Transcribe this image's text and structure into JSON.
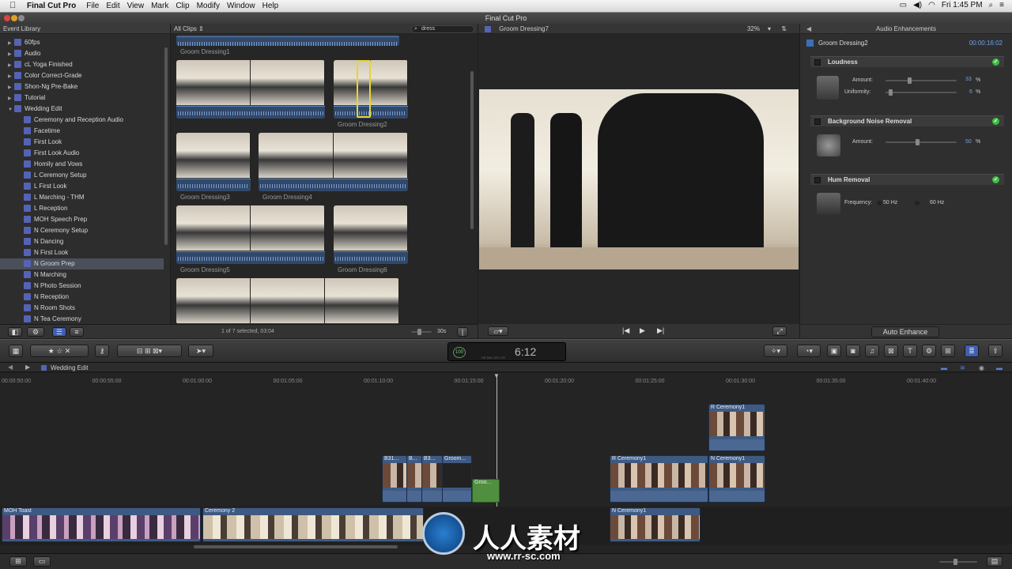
{
  "menubar": {
    "app": "Final Cut Pro",
    "items": [
      "File",
      "Edit",
      "View",
      "Mark",
      "Clip",
      "Modify",
      "Window",
      "Help"
    ],
    "clock": "Fri 1:45 PM"
  },
  "window": {
    "title": "Final Cut Pro"
  },
  "library": {
    "header": "Event Library",
    "items": [
      {
        "label": "60fps",
        "level": 0
      },
      {
        "label": "Audio",
        "level": 0
      },
      {
        "label": "cL Yoga Finished",
        "level": 0
      },
      {
        "label": "Color Correct-Grade",
        "level": 0
      },
      {
        "label": "Shon-Ng Pre-Bake",
        "level": 0
      },
      {
        "label": "Tutorial",
        "level": 0
      },
      {
        "label": "Wedding Edit",
        "level": 0,
        "open": true
      },
      {
        "label": "Ceremony and Reception Audio",
        "level": 1
      },
      {
        "label": "Facetime",
        "level": 1
      },
      {
        "label": "First Look",
        "level": 1
      },
      {
        "label": "First Look Audio",
        "level": 1
      },
      {
        "label": "Homily and Vows",
        "level": 1
      },
      {
        "label": "L Ceremony Setup",
        "level": 1
      },
      {
        "label": "L First Look",
        "level": 1
      },
      {
        "label": "L Marching - THM",
        "level": 1
      },
      {
        "label": "L Reception",
        "level": 1
      },
      {
        "label": "MOH Speech Prep",
        "level": 1
      },
      {
        "label": "N Ceremony Setup",
        "level": 1
      },
      {
        "label": "N Dancing",
        "level": 1
      },
      {
        "label": "N First Look",
        "level": 1
      },
      {
        "label": "N Groom Prep",
        "level": 1,
        "selected": true
      },
      {
        "label": "N Marching",
        "level": 1
      },
      {
        "label": "N Photo Session",
        "level": 1
      },
      {
        "label": "N Reception",
        "level": 1
      },
      {
        "label": "N Room Shots",
        "level": 1
      },
      {
        "label": "N Tea Ceremony",
        "level": 1
      }
    ]
  },
  "browser": {
    "filter": "All Clips",
    "search": "dress",
    "status": "1 of 7 selected, 03:04",
    "duration": "30s",
    "clips": [
      "Groom Dressing1",
      "Groom Dressing2",
      "Groom Dressing3",
      "Groom Dressing4",
      "Groom Dressing5",
      "Groom Dressing6"
    ]
  },
  "viewer": {
    "title": "Groom Dressing7",
    "zoom": "32%"
  },
  "inspector": {
    "header": "Audio Enhancements",
    "clip": "Groom Dressing2",
    "timecode": "00:00:16:02",
    "loudness": {
      "title": "Loudness",
      "amount_label": "Amount:",
      "amount": "33",
      "uniformity_label": "Uniformity:",
      "uniformity": "6",
      "unit": "%"
    },
    "noise": {
      "title": "Background Noise Removal",
      "amount_label": "Amount:",
      "amount": "50",
      "unit": "%"
    },
    "hum": {
      "title": "Hum Removal",
      "freq_label": "Frequency:",
      "f1": "50 Hz",
      "f2": "60 Hz"
    },
    "auto": "Auto Enhance"
  },
  "timecode": {
    "display": "6:12",
    "labels": "HR MIN SEC FR",
    "badge": "100"
  },
  "timeline": {
    "project": "Wedding Edit",
    "ruler": [
      "00:00:50:00",
      "00:00:55:00",
      "00:01:00:00",
      "00:01:05:00",
      "00:01:10:00",
      "00:01:15:00",
      "00:01:20:00",
      "00:01:25:00",
      "00:01:30:00",
      "00:01:35:00",
      "00:01:40:00"
    ],
    "clips": [
      "MOH Toast",
      "Ceremony 2",
      "B31...",
      "B...",
      "B3...",
      "Groom...",
      "Groo...",
      "R Ceremony1",
      "N Ceremony1",
      "R Ceremony1",
      "N Ceremony1"
    ]
  },
  "watermark": {
    "text": "人人素材",
    "url": "www.rr-sc.com"
  },
  "colors": {
    "accent": "#5563b5",
    "check": "#3cbf3c",
    "value": "#6fa0e8"
  }
}
